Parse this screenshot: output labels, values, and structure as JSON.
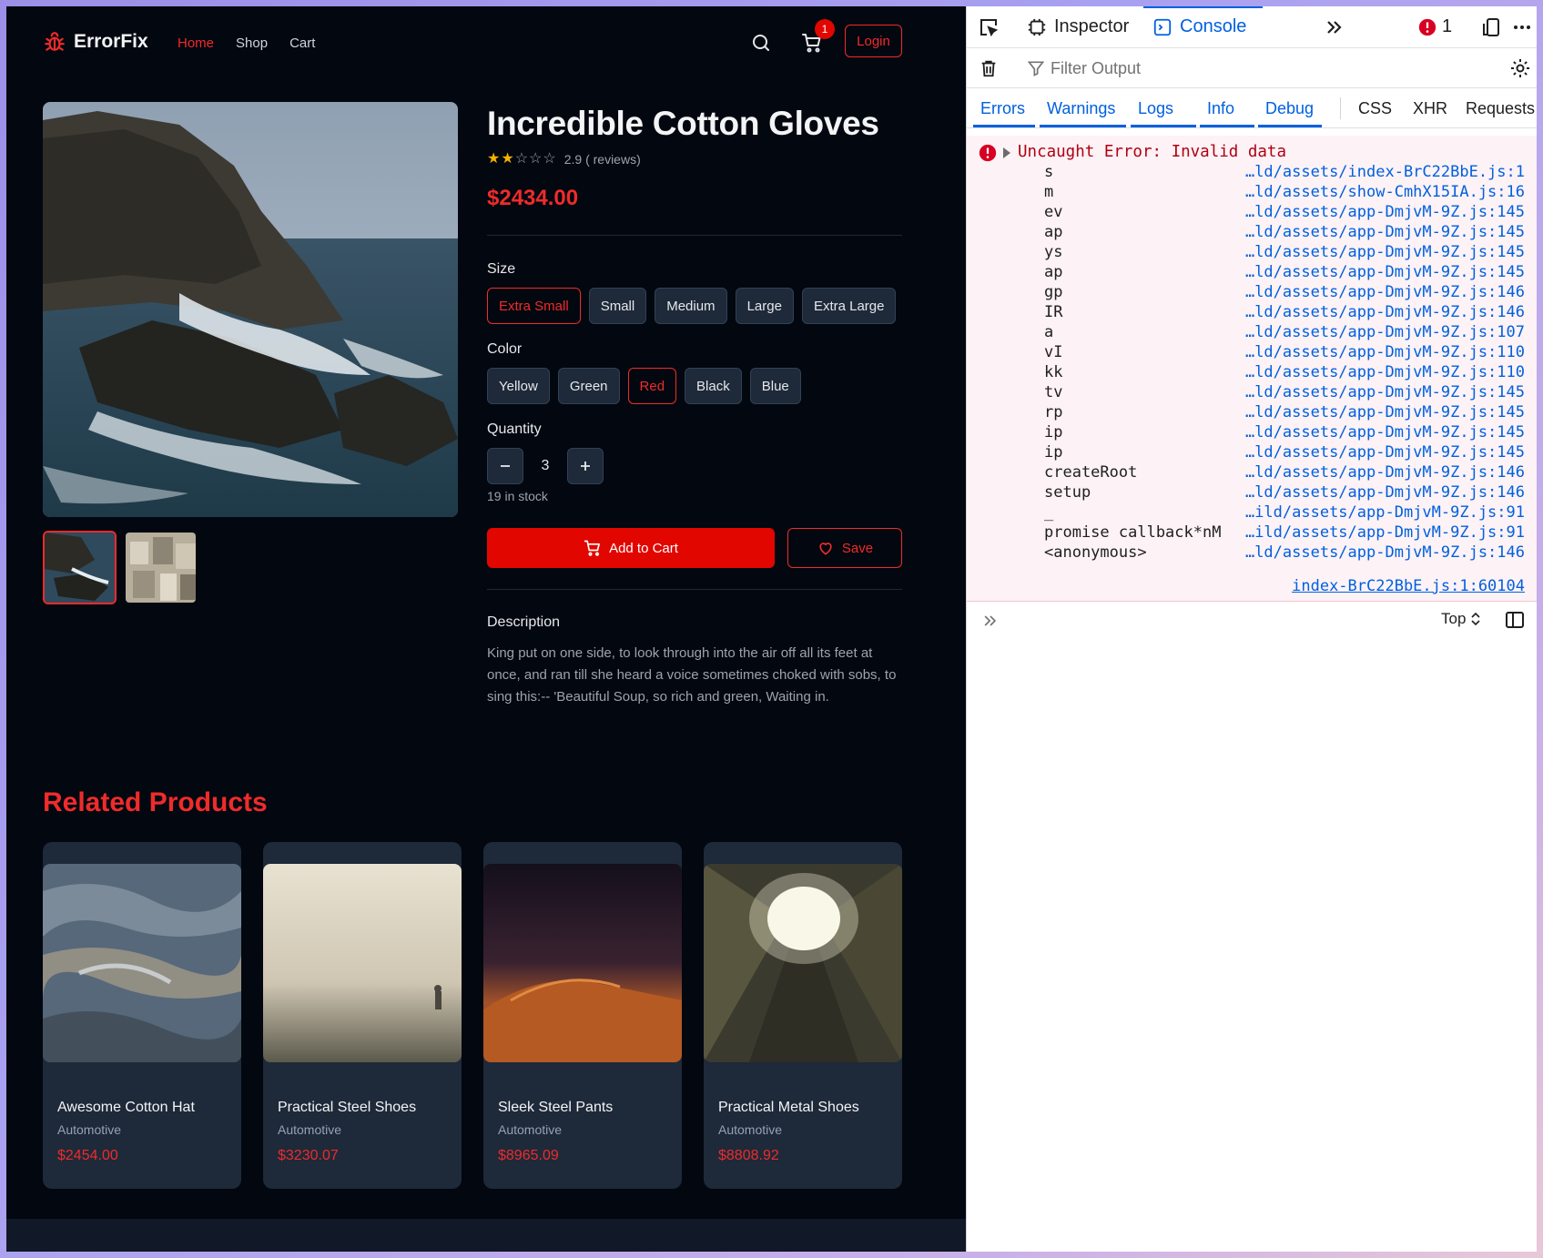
{
  "app": {
    "brand": "ErrorFix",
    "nav": [
      {
        "label": "Home",
        "active": true
      },
      {
        "label": "Shop",
        "active": false
      },
      {
        "label": "Cart",
        "active": false
      }
    ],
    "cart_count": "1",
    "login_label": "Login",
    "accent_color": "#ef2b2b"
  },
  "product": {
    "title": "Incredible Cotton Gloves",
    "rating_value": 2.9,
    "rating_text": "2.9 ( reviews)",
    "price": "$2434.00",
    "size_label": "Size",
    "sizes": [
      "Extra Small",
      "Small",
      "Medium",
      "Large",
      "Extra Large"
    ],
    "selected_size": "Extra Small",
    "color_label": "Color",
    "colors": [
      "Yellow",
      "Green",
      "Red",
      "Black",
      "Blue"
    ],
    "selected_color": "Red",
    "quantity_label": "Quantity",
    "quantity": "3",
    "stock": "19 in stock",
    "add_to_cart": "Add to Cart",
    "save": "Save",
    "description_title": "Description",
    "description": "King put on one side, to look through into the air off all its feet at once, and ran till she heard a voice sometimes choked with sobs, to sing this:-- 'Beautiful Soup, so rich and green, Waiting in."
  },
  "related": {
    "title": "Related Products",
    "items": [
      {
        "name": "Awesome Cotton Hat",
        "category": "Automotive",
        "price": "$2454.00"
      },
      {
        "name": "Practical Steel Shoes",
        "category": "Automotive",
        "price": "$3230.07"
      },
      {
        "name": "Sleek Steel Pants",
        "category": "Automotive",
        "price": "$8965.09"
      },
      {
        "name": "Practical Metal Shoes",
        "category": "Automotive",
        "price": "$8808.92"
      }
    ]
  },
  "devtools": {
    "tabs": {
      "inspector": "Inspector",
      "console": "Console"
    },
    "error_count": "1",
    "filter_placeholder": "Filter Output",
    "levels": [
      "Errors",
      "Warnings",
      "Logs",
      "Info",
      "Debug"
    ],
    "extra_filters": [
      "CSS",
      "XHR",
      "Requests"
    ],
    "error_message": "Uncaught Error: Invalid data",
    "frames": [
      {
        "fn": "s",
        "loc": "…ld/assets/index-BrC22BbE.js:1"
      },
      {
        "fn": "m",
        "loc": "…ld/assets/show-CmhX15IA.js:16"
      },
      {
        "fn": "ev",
        "loc": "…ld/assets/app-DmjvM-9Z.js:145"
      },
      {
        "fn": "ap",
        "loc": "…ld/assets/app-DmjvM-9Z.js:145"
      },
      {
        "fn": "ys",
        "loc": "…ld/assets/app-DmjvM-9Z.js:145"
      },
      {
        "fn": "ap",
        "loc": "…ld/assets/app-DmjvM-9Z.js:145"
      },
      {
        "fn": "gp",
        "loc": "…ld/assets/app-DmjvM-9Z.js:146"
      },
      {
        "fn": "IR",
        "loc": "…ld/assets/app-DmjvM-9Z.js:146"
      },
      {
        "fn": "a",
        "loc": "…ld/assets/app-DmjvM-9Z.js:107"
      },
      {
        "fn": "vI",
        "loc": "…ld/assets/app-DmjvM-9Z.js:110"
      },
      {
        "fn": "kk",
        "loc": "…ld/assets/app-DmjvM-9Z.js:110"
      },
      {
        "fn": "tv",
        "loc": "…ld/assets/app-DmjvM-9Z.js:145"
      },
      {
        "fn": "rp",
        "loc": "…ld/assets/app-DmjvM-9Z.js:145"
      },
      {
        "fn": "ip",
        "loc": "…ld/assets/app-DmjvM-9Z.js:145"
      },
      {
        "fn": "ip",
        "loc": "…ld/assets/app-DmjvM-9Z.js:145"
      },
      {
        "fn": "createRoot",
        "loc": "…ld/assets/app-DmjvM-9Z.js:146"
      },
      {
        "fn": "setup",
        "loc": "…ld/assets/app-DmjvM-9Z.js:146"
      },
      {
        "fn": "_",
        "loc": "…ild/assets/app-DmjvM-9Z.js:91"
      },
      {
        "fn": "promise callback*nM",
        "loc": "…ild/assets/app-DmjvM-9Z.js:91"
      },
      {
        "fn": "<anonymous>",
        "loc": "…ld/assets/app-DmjvM-9Z.js:146"
      }
    ],
    "error_source": "index-BrC22BbE.js:1:60104",
    "context_selector": "Top"
  }
}
